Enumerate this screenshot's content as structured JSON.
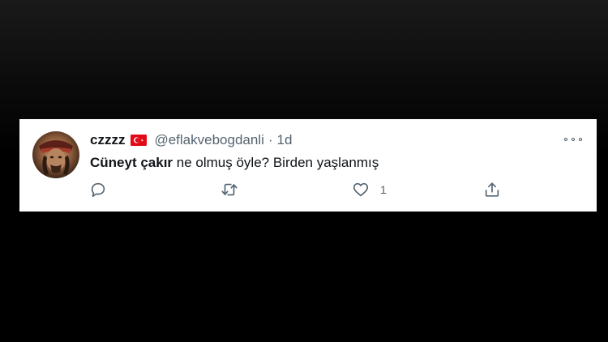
{
  "tweet": {
    "author": {
      "display_name": "czzzz",
      "handle": "@eflakvebogdanli",
      "flag_icon": "turkey-flag-icon"
    },
    "separator": "·",
    "timestamp": "1d",
    "text": {
      "mention": "Cüneyt çakır",
      "body": " ne olmuş öyle? Birden yaşlanmış"
    },
    "actions": {
      "reply": {
        "icon": "reply-icon",
        "count": ""
      },
      "retweet": {
        "icon": "retweet-icon",
        "count": ""
      },
      "like": {
        "icon": "heart-icon",
        "count": "1"
      },
      "share": {
        "icon": "share-icon",
        "count": ""
      }
    },
    "more_icon": "more-options-icon"
  },
  "colors": {
    "background": "#000000",
    "card": "#ffffff",
    "primary_text": "#0f1419",
    "secondary_text": "#536471",
    "flag_red": "#e30a17"
  }
}
